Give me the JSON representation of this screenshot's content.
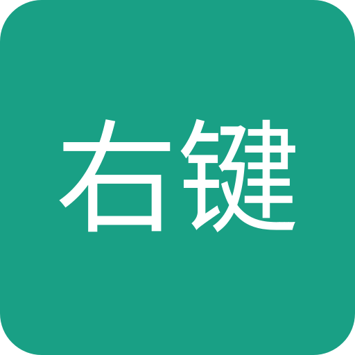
{
  "icon": {
    "label": "右键",
    "background_color": "#19a085",
    "text_color": "#ffffff"
  }
}
